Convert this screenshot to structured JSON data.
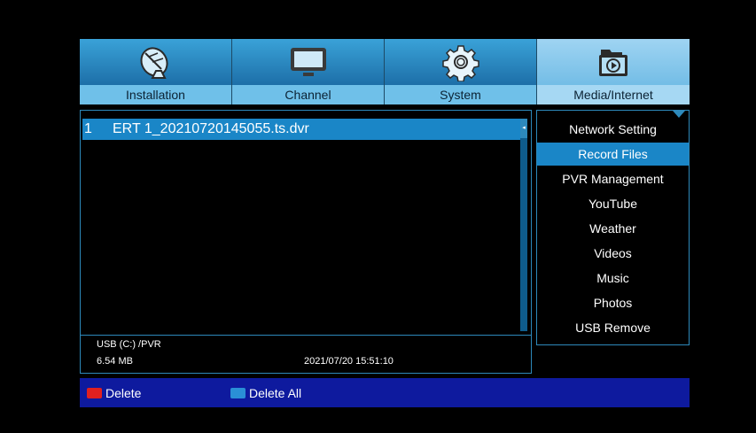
{
  "tabs": [
    {
      "label": "Installation",
      "icon": "satellite-dish-icon",
      "active": false
    },
    {
      "label": "Channel",
      "icon": "tv-icon",
      "active": false
    },
    {
      "label": "System",
      "icon": "gear-icon",
      "active": false
    },
    {
      "label": "Media/Internet",
      "icon": "media-folder-icon",
      "active": true
    }
  ],
  "filelist": {
    "items": [
      {
        "number": "1",
        "name": "ERT 1_20210720145055.ts.dvr",
        "selected": true
      }
    ],
    "path": "USB (C:) /PVR",
    "size": "6.54 MB",
    "datetime": "2021/07/20 15:51:10"
  },
  "menu": {
    "items": [
      {
        "label": "Network Setting",
        "selected": false
      },
      {
        "label": "Record Files",
        "selected": true
      },
      {
        "label": "PVR Management",
        "selected": false
      },
      {
        "label": "YouTube",
        "selected": false
      },
      {
        "label": "Weather",
        "selected": false
      },
      {
        "label": "Videos",
        "selected": false
      },
      {
        "label": "Music",
        "selected": false
      },
      {
        "label": "Photos",
        "selected": false
      },
      {
        "label": "USB Remove",
        "selected": false
      }
    ]
  },
  "bottombar": {
    "delete_label": "Delete",
    "delete_all_label": "Delete All",
    "red_key_color": "#e02020",
    "blue_key_color": "#2a8fd6"
  },
  "colors": {
    "selection": "#1a86c7",
    "border": "#2d89bb",
    "bottombar": "#0e1a9e"
  }
}
